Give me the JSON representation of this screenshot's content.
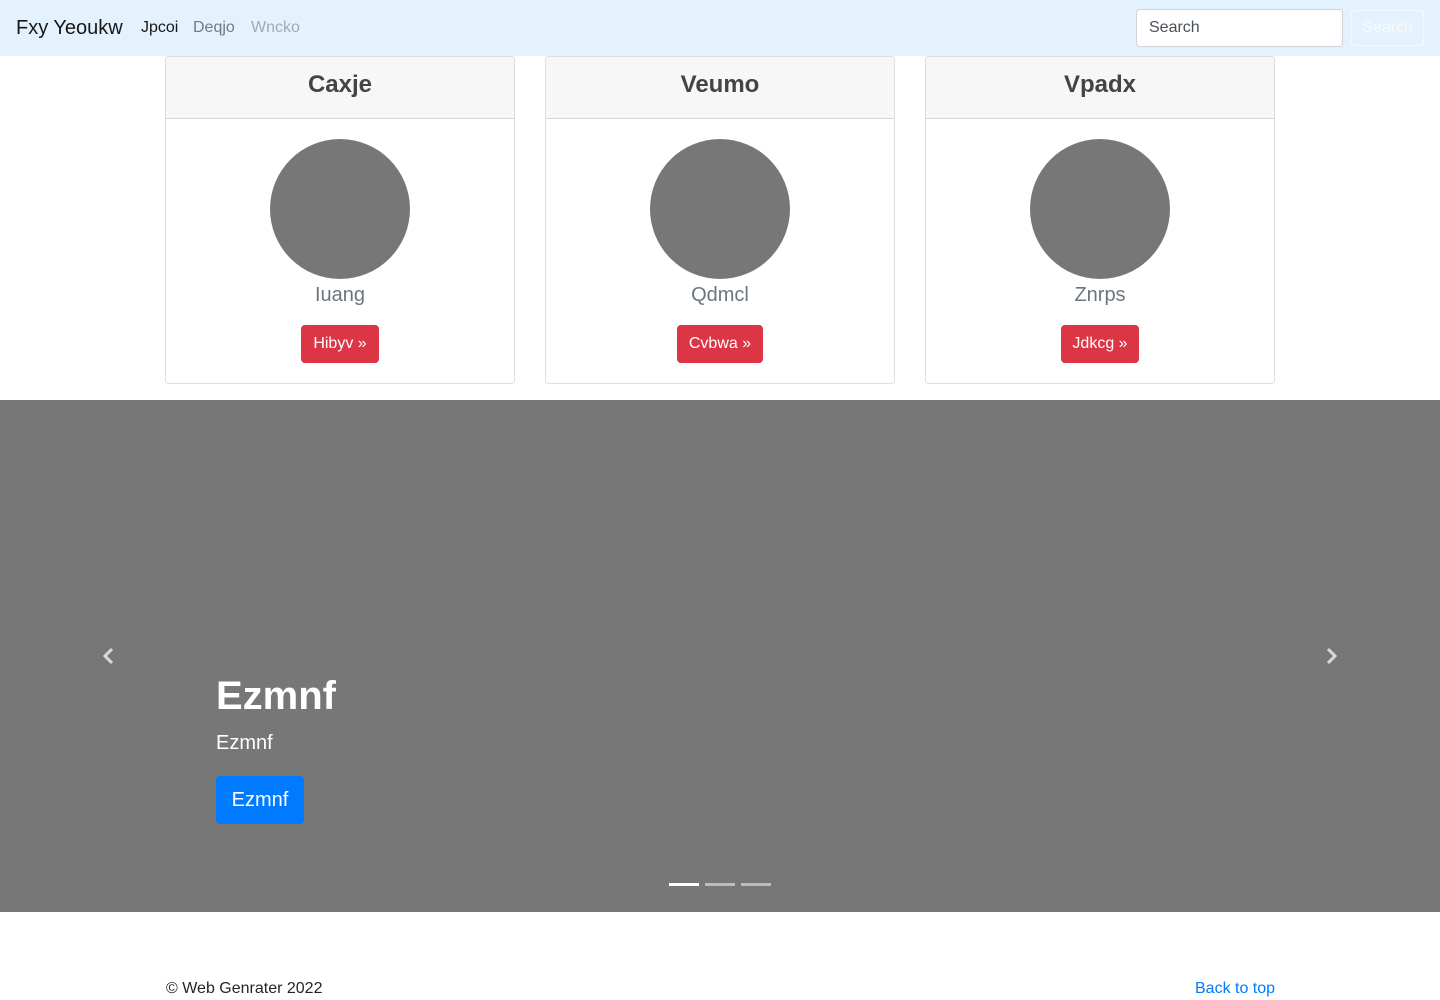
{
  "navbar": {
    "brand": "Fxy Yeoukw",
    "links": [
      {
        "label": "Jpcoi"
      },
      {
        "label": "Deqjo"
      },
      {
        "label": "Wncko"
      }
    ],
    "search": {
      "placeholder": "Search",
      "button_label": "Search"
    }
  },
  "cards": [
    {
      "title": "Caxje",
      "subtitle": "Iuang",
      "button_label": "Hibyv »"
    },
    {
      "title": "Veumo",
      "subtitle": "Qdmcl",
      "button_label": "Cvbwa »"
    },
    {
      "title": "Vpadx",
      "subtitle": "Znrps",
      "button_label": "Jdkcg »"
    }
  ],
  "carousel": {
    "slide_title": "Ezmnf",
    "slide_text": "Ezmnf",
    "slide_button": "Ezmnf",
    "indicator_count": 3,
    "active_index": 0,
    "icons": {
      "prev": "chevron-left-icon",
      "next": "chevron-right-icon"
    }
  },
  "footer": {
    "copyright": "© Web Genrater 2022",
    "back_to_top": "Back to top"
  },
  "colors": {
    "navbar_bg": "#e3f2fd",
    "card_button": "#dc3545",
    "carousel_bg": "#777777",
    "primary": "#007bff",
    "placeholder_gray": "#777777"
  }
}
